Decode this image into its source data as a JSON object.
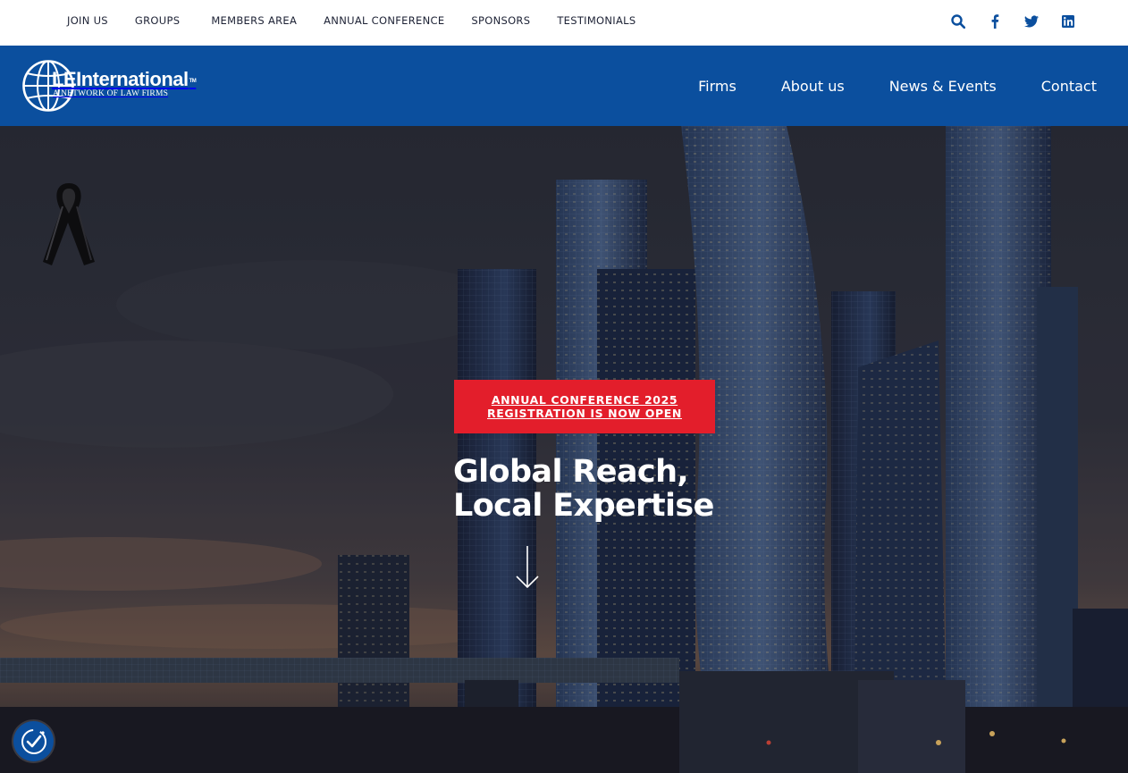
{
  "topbar": {
    "links": [
      {
        "label": "JOIN US"
      },
      {
        "label": "GROUPS"
      },
      {
        "label": "MEMBERS AREA"
      },
      {
        "label": "ANNUAL CONFERENCE"
      },
      {
        "label": "SPONSORS"
      },
      {
        "label": "TESTIMONIALS"
      }
    ],
    "icons": [
      "search-icon",
      "facebook-icon",
      "twitter-icon",
      "linkedin-icon"
    ],
    "icon_color": "#0b4f9e"
  },
  "header": {
    "logo_name": "LEInternational",
    "logo_tm": "TM",
    "logo_tagline": "A NETWORK OF LAW FIRMS",
    "nav": [
      {
        "label": "Firms"
      },
      {
        "label": "About us"
      },
      {
        "label": "News & Events"
      },
      {
        "label": "Contact"
      }
    ],
    "background": "#0b4f9e"
  },
  "hero": {
    "cta_line1": "ANNUAL CONFERENCE 2025",
    "cta_line2": "REGISTRATION IS NOW OPEN",
    "cta_color": "#e31e2b",
    "headline_line1": "Global Reach,",
    "headline_line2": "Local Expertise",
    "mourning_icon": "black-ribbon-icon",
    "scroll_icon": "arrow-down-icon"
  },
  "accessibility": {
    "icon": "accessibility-icon"
  }
}
